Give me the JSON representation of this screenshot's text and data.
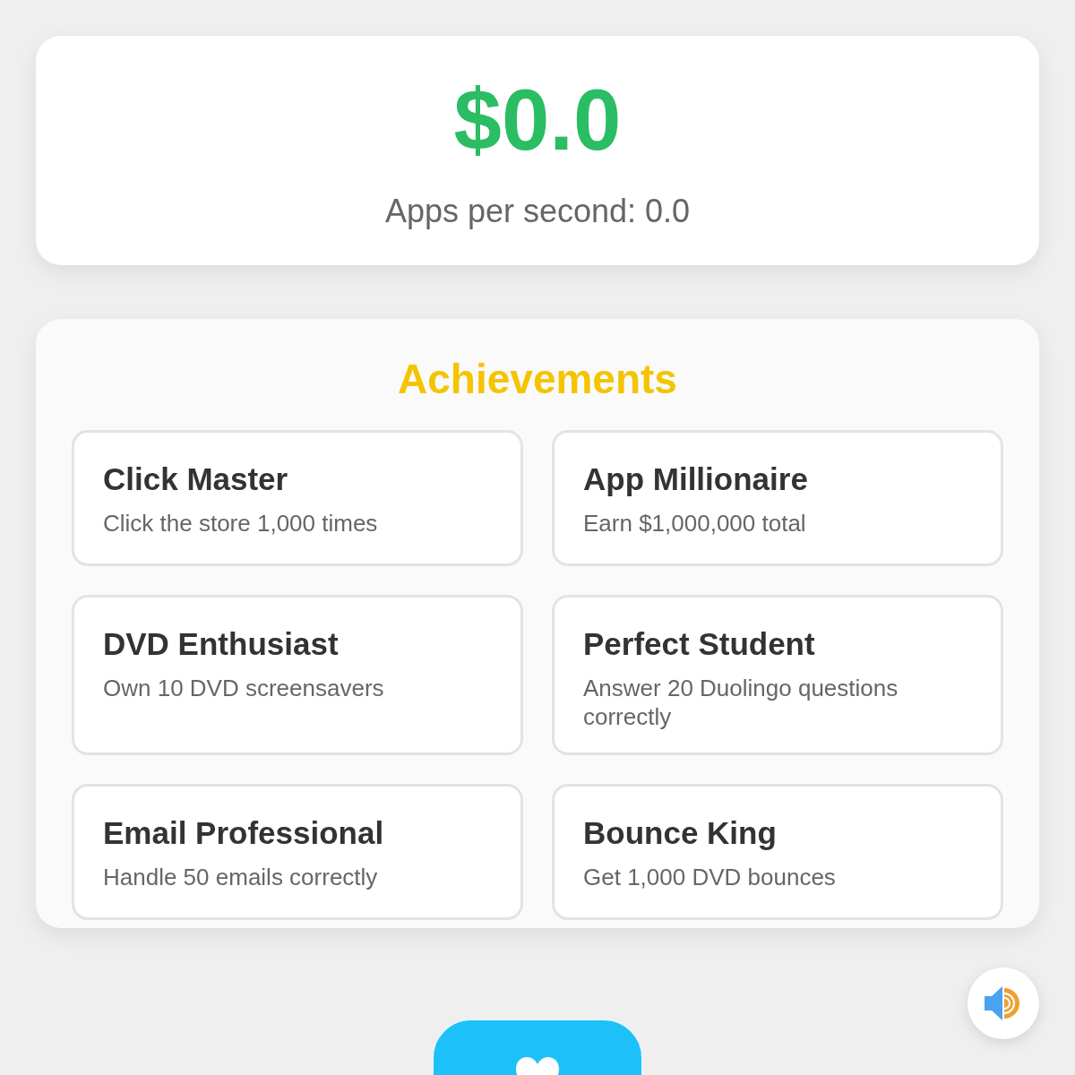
{
  "balance": {
    "amount": "$0.0",
    "rate": "Apps per second: 0.0"
  },
  "achievements": {
    "title": "Achievements",
    "items": [
      {
        "name": "Click Master",
        "description": "Click the store 1,000 times"
      },
      {
        "name": "App Millionaire",
        "description": "Earn $1,000,000 total"
      },
      {
        "name": "DVD Enthusiast",
        "description": "Own 10 DVD screensavers"
      },
      {
        "name": "Perfect Student",
        "description": "Answer 20 Duolingo questions correctly"
      },
      {
        "name": "Email Professional",
        "description": "Handle 50 emails correctly"
      },
      {
        "name": "Bounce King",
        "description": "Get 1,000 DVD bounces"
      }
    ]
  }
}
